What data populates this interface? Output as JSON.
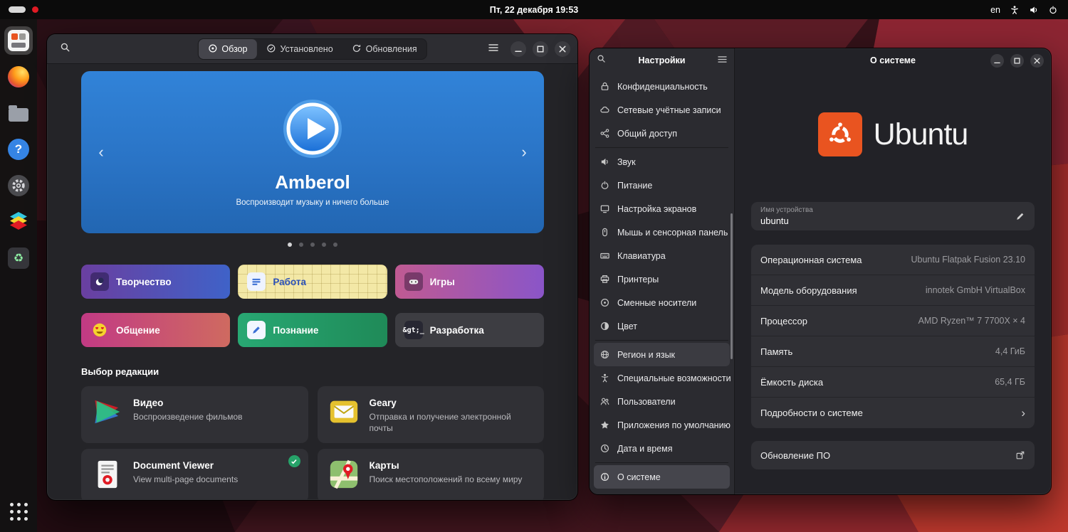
{
  "icons": {
    "help_glyph": "?",
    "recycle_glyph": "♻",
    "terminal_glyph": "&gt;_",
    "chevron_right": "›"
  },
  "topbar": {
    "clock": "Пт, 22 декабря  19:53",
    "keyboard_layout": "en"
  },
  "software": {
    "tabs": [
      {
        "label": "Обзор"
      },
      {
        "label": "Установлено"
      },
      {
        "label": "Обновления"
      }
    ],
    "carousel": {
      "prev": "‹",
      "next": "›",
      "app_name": "Amberol",
      "app_subtitle": "Воспроизводит музыку и ничего больше"
    },
    "categories": [
      {
        "label": "Творчество"
      },
      {
        "label": "Работа"
      },
      {
        "label": "Игры"
      },
      {
        "label": "Общение"
      },
      {
        "label": "Познание"
      },
      {
        "label": "Разработка"
      }
    ],
    "editors_choice": {
      "title": "Выбор редакции",
      "apps": [
        {
          "name": "Видео",
          "desc": "Воспроизведение фильмов"
        },
        {
          "name": "Geary",
          "desc": "Отправка и получение электронной почты"
        },
        {
          "name": "Document Viewer",
          "desc": "View multi-page documents"
        },
        {
          "name": "Карты",
          "desc": "Поиск местоположений по всему миру"
        }
      ]
    }
  },
  "settings": {
    "sidebar_title": "Настройки",
    "items": [
      {
        "label": "Конфиденциальность"
      },
      {
        "label": "Сетевые учётные записи"
      },
      {
        "label": "Общий доступ"
      },
      {
        "label": "Звук"
      },
      {
        "label": "Питание"
      },
      {
        "label": "Настройка экранов"
      },
      {
        "label": "Мышь и сенсорная панель"
      },
      {
        "label": "Клавиатура"
      },
      {
        "label": "Принтеры"
      },
      {
        "label": "Сменные носители"
      },
      {
        "label": "Цвет"
      },
      {
        "label": "Регион и язык"
      },
      {
        "label": "Специальные возможности"
      },
      {
        "label": "Пользователи"
      },
      {
        "label": "Приложения по умолчанию"
      },
      {
        "label": "Дата и время"
      },
      {
        "label": "О системе"
      }
    ],
    "about": {
      "title": "О системе",
      "logo_text": "Ubuntu",
      "device_name_label": "Имя устройства",
      "device_name_value": "ubuntu",
      "rows": [
        {
          "label": "Операционная система",
          "value": "Ubuntu Flatpak Fusion 23.10"
        },
        {
          "label": "Модель оборудования",
          "value": "innotek GmbH VirtualBox"
        },
        {
          "label": "Процессор",
          "value": "AMD Ryzen™ 7 7700X × 4"
        },
        {
          "label": "Память",
          "value": "4,4 ГиБ"
        },
        {
          "label": "Ёмкость диска",
          "value": "65,4 ГБ"
        },
        {
          "label": "Подробности о системе",
          "value": ""
        }
      ],
      "software_update": "Обновление ПО"
    }
  }
}
